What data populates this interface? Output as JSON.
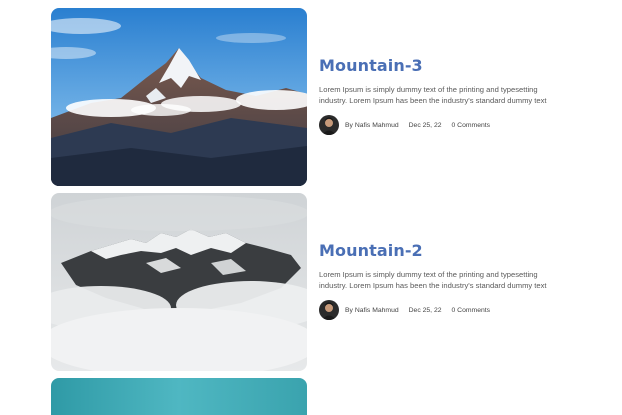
{
  "posts": [
    {
      "title": "Mountain-3",
      "excerpt_line1": "Lorem Ipsum is simply dummy text of the printing and typesetting",
      "excerpt_line2": "industry. Lorem Ipsum has been the industry's standard dummy text",
      "author": "By Nafis Mahmud",
      "date": "Dec 25, 22",
      "comments": "0 Comments",
      "image": "mountain-peak-blue-sky-image"
    },
    {
      "title": "Mountain-2",
      "excerpt_line1": "Lorem Ipsum is simply dummy text of the printing and typesetting",
      "excerpt_line2": "industry. Lorem Ipsum has been the industry's standard dummy text",
      "author": "By Nafis Mahmud",
      "date": "Dec 25, 22",
      "comments": "0 Comments",
      "image": "misty-snow-mountain-image"
    },
    {
      "image": "teal-sky-image"
    }
  ],
  "colors": {
    "title": "#4a6fb5",
    "text": "#5a5a5a"
  }
}
